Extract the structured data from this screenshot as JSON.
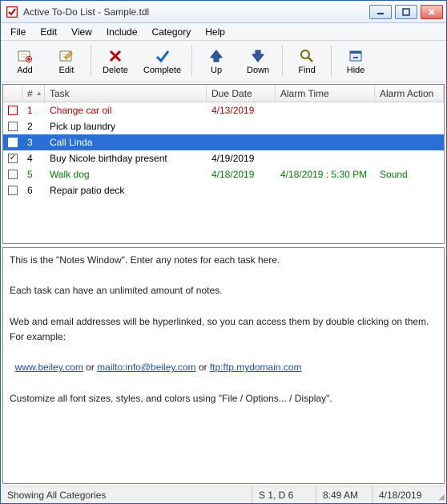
{
  "title": "Active To-Do List - Sample.tdl",
  "menu": [
    "File",
    "Edit",
    "View",
    "Include",
    "Category",
    "Help"
  ],
  "toolbar": [
    {
      "label": "Add",
      "icon": "add"
    },
    {
      "label": "Edit",
      "icon": "edit"
    },
    {
      "sep": true
    },
    {
      "label": "Delete",
      "icon": "delete"
    },
    {
      "label": "Complete",
      "icon": "complete"
    },
    {
      "sep": true
    },
    {
      "label": "Up",
      "icon": "up"
    },
    {
      "label": "Down",
      "icon": "down"
    },
    {
      "sep": true
    },
    {
      "label": "Find",
      "icon": "find"
    },
    {
      "sep": true
    },
    {
      "label": "Hide",
      "icon": "hide"
    }
  ],
  "columns": {
    "check": "",
    "num": "#",
    "task": "Task",
    "due": "Due Date",
    "alarm": "Alarm Time",
    "action": "Alarm Action"
  },
  "tasks": [
    {
      "n": "1",
      "task": "Change car oil",
      "due": "4/13/2019",
      "alarm": "",
      "action": "",
      "checked": false,
      "style": "red"
    },
    {
      "n": "2",
      "task": "Pick up laundry",
      "due": "",
      "alarm": "",
      "action": "",
      "checked": false,
      "style": ""
    },
    {
      "n": "3",
      "task": "Call Linda",
      "due": "",
      "alarm": "",
      "action": "",
      "checked": false,
      "style": "",
      "selected": true
    },
    {
      "n": "4",
      "task": "Buy Nicole birthday present",
      "due": "4/19/2019",
      "alarm": "",
      "action": "",
      "checked": true,
      "style": ""
    },
    {
      "n": "5",
      "task": "Walk dog",
      "due": "4/18/2019",
      "alarm": "4/18/2019 : 5:30 PM",
      "action": "Sound",
      "checked": false,
      "style": "green"
    },
    {
      "n": "6",
      "task": "Repair patio deck",
      "due": "",
      "alarm": "",
      "action": "",
      "checked": false,
      "style": ""
    }
  ],
  "notes": {
    "p1": "This is the \"Notes Window\".  Enter any notes for each task here.",
    "p2": "Each task can have an unlimited amount of notes.",
    "p3": "Web and email addresses will be hyperlinked, so you can access them by double clicking on them.  For example:",
    "link1": "www.beiley.com",
    "or1": " or ",
    "link2": "mailto:info@beiley.com",
    "or2": " or ",
    "link3": "ftp:ftp.mydomain.com",
    "p4": "Customize all font sizes, styles, and colors using \"File / Options... / Display\"."
  },
  "status": {
    "cat": "Showing All Categories",
    "sel": "S 1, D 6",
    "time": "8:49 AM",
    "date": "4/18/2019"
  }
}
